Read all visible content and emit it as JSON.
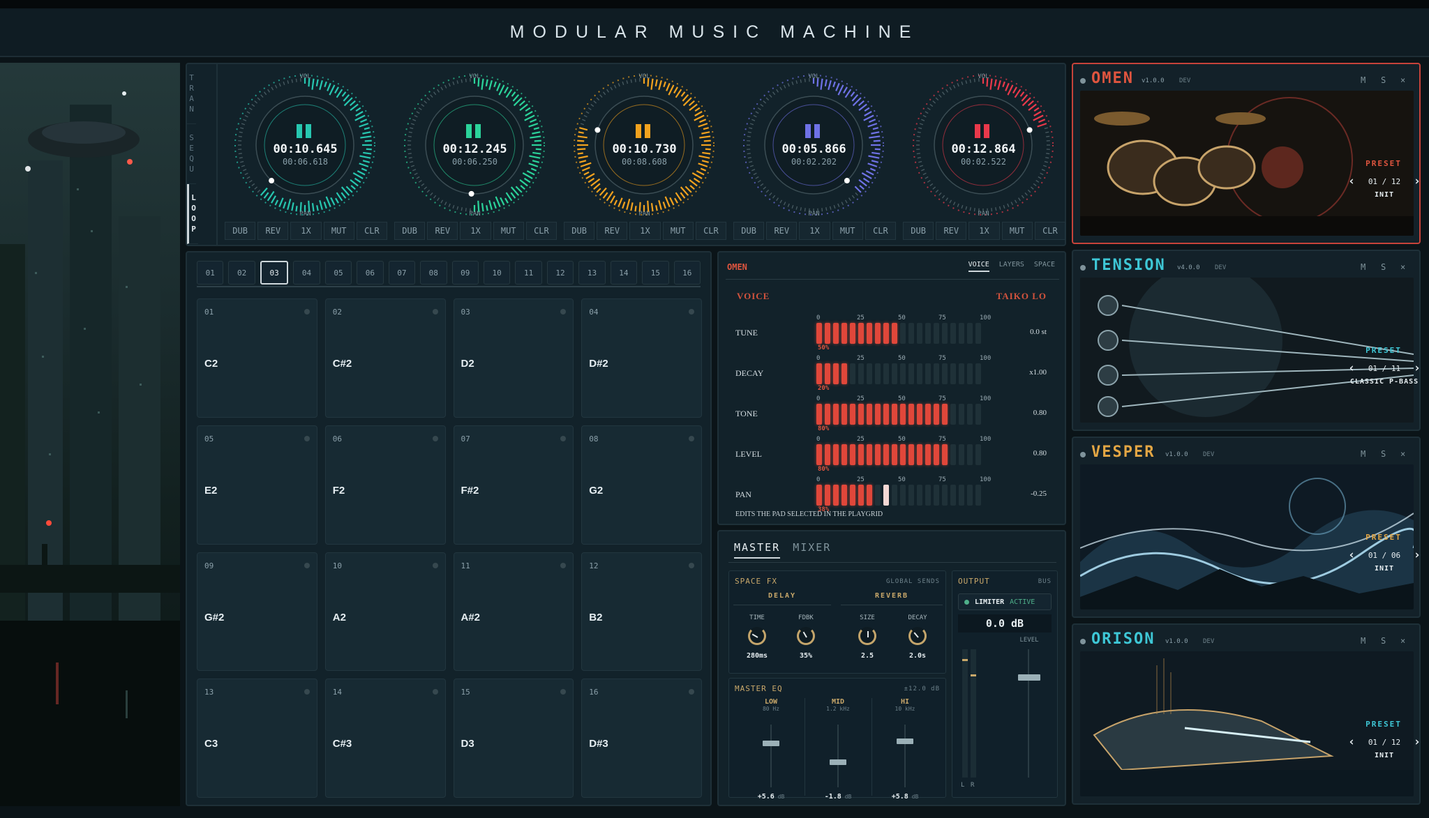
{
  "app": {
    "title": "MODULAR MUSIC MACHINE"
  },
  "transport": {
    "modes": [
      "TRAN",
      "SEQU",
      "LOOP"
    ],
    "active_mode": "LOOP",
    "decks": [
      {
        "color": "#27c7b0",
        "time": "00:10.645",
        "sub": "00:06.618",
        "vol_label": "VOL",
        "pan_label": "PAN",
        "buttons": [
          "DUB",
          "REV",
          "1X",
          "MUT",
          "CLR"
        ],
        "progress": 0.62
      },
      {
        "color": "#2bd39a",
        "time": "00:12.245",
        "sub": "00:06.250",
        "vol_label": "VOL",
        "pan_label": "PAN",
        "buttons": [
          "DUB",
          "REV",
          "1X",
          "MUT",
          "CLR"
        ],
        "progress": 0.51
      },
      {
        "color": "#f2a21e",
        "time": "00:10.730",
        "sub": "00:08.608",
        "vol_label": "VOL",
        "pan_label": "PAN",
        "buttons": [
          "DUB",
          "REV",
          "1X",
          "MUT",
          "CLR"
        ],
        "progress": 0.8
      },
      {
        "color": "#6f72e6",
        "time": "00:05.866",
        "sub": "00:02.202",
        "vol_label": "VOL",
        "pan_label": "PAN",
        "buttons": [
          "DUB",
          "REV",
          "1X",
          "MUT",
          "CLR"
        ],
        "progress": 0.38
      },
      {
        "color": "#e9394b",
        "time": "00:12.864",
        "sub": "00:02.522",
        "vol_label": "VOL",
        "pan_label": "PAN",
        "buttons": [
          "DUB",
          "REV",
          "1X",
          "MUT",
          "CLR"
        ],
        "progress": 0.2
      }
    ]
  },
  "pads": {
    "tabs": [
      "01",
      "02",
      "03",
      "04",
      "05",
      "06",
      "07",
      "08",
      "09",
      "10",
      "11",
      "12",
      "13",
      "14",
      "15",
      "16"
    ],
    "active_tab": "03",
    "items": [
      {
        "num": "01",
        "note": "C2"
      },
      {
        "num": "02",
        "note": "C#2"
      },
      {
        "num": "03",
        "note": "D2"
      },
      {
        "num": "04",
        "note": "D#2"
      },
      {
        "num": "05",
        "note": "E2"
      },
      {
        "num": "06",
        "note": "F2"
      },
      {
        "num": "07",
        "note": "F#2"
      },
      {
        "num": "08",
        "note": "G2"
      },
      {
        "num": "09",
        "note": "G#2"
      },
      {
        "num": "10",
        "note": "A2"
      },
      {
        "num": "11",
        "note": "A#2"
      },
      {
        "num": "12",
        "note": "B2"
      },
      {
        "num": "13",
        "note": "C3"
      },
      {
        "num": "14",
        "note": "C#3"
      },
      {
        "num": "15",
        "note": "D3"
      },
      {
        "num": "16",
        "note": "D#3"
      }
    ]
  },
  "voice": {
    "instrument": "OMEN",
    "tabs": [
      "VOICE",
      "LAYERS",
      "SPACE"
    ],
    "active_tab": "VOICE",
    "label": "VOICE",
    "preset": "TAIKO LO",
    "ticks": [
      "0",
      "25",
      "50",
      "75",
      "100"
    ],
    "params": [
      {
        "name": "TUNE",
        "percent": "50%",
        "value": "0.0 st",
        "level": 0.5
      },
      {
        "name": "DECAY",
        "percent": "20%",
        "value": "x1.00",
        "level": 0.2
      },
      {
        "name": "TONE",
        "percent": "80%",
        "value": "0.80",
        "level": 0.8
      },
      {
        "name": "LEVEL",
        "percent": "80%",
        "value": "0.80",
        "level": 0.8
      },
      {
        "name": "PAN",
        "percent": "38%",
        "value": "-0.25",
        "level": 0.38
      }
    ],
    "note": "EDITS THE PAD SELECTED IN THE PLAYGRID"
  },
  "master": {
    "tabs": [
      "MASTER",
      "MIXER"
    ],
    "active_tab": "MASTER",
    "space_fx": {
      "title": "SPACE FX",
      "sub": "GLOBAL SENDS",
      "delay": "DELAY",
      "reverb": "REVERB",
      "knobs": [
        {
          "label": "TIME",
          "value": "280ms"
        },
        {
          "label": "FDBK",
          "value": "35%"
        },
        {
          "label": "SIZE",
          "value": "2.5"
        },
        {
          "label": "DECAY",
          "value": "2.0s"
        }
      ]
    },
    "eq": {
      "title": "MASTER EQ",
      "range": "±12.0 dB",
      "bands": [
        {
          "name": "LOW",
          "freq": "80 Hz",
          "value": "+5.6",
          "unit": "dB",
          "pos": 0.25
        },
        {
          "name": "MID",
          "freq": "1.2 kHz",
          "value": "-1.8",
          "unit": "dB",
          "pos": 0.55
        },
        {
          "name": "HI",
          "freq": "10 kHz",
          "value": "+5.8",
          "unit": "dB",
          "pos": 0.22
        }
      ]
    },
    "output": {
      "title": "OUTPUT",
      "sub": "BUS",
      "limiter": "LIMITER",
      "limiter_state": "ACTIVE",
      "db": "0.0 dB",
      "level_label": "LEVEL",
      "l": "L",
      "r": "R"
    }
  },
  "instruments": [
    {
      "name": "OMEN",
      "version": "v1.0.0",
      "dev": "DEV",
      "color": "#e0553f",
      "preset_label": "PRESET",
      "counter": "01 / 12",
      "preset": "INIT",
      "m": "M",
      "s": "S",
      "x": "×",
      "art": "drums"
    },
    {
      "name": "TENSION",
      "version": "v4.0.0",
      "dev": "DEV",
      "color": "#3ec7d6",
      "preset_label": "PRESET",
      "counter": "01 / 11",
      "preset": "CLASSIC P-BASS",
      "m": "M",
      "s": "S",
      "x": "×",
      "art": "bass"
    },
    {
      "name": "VESPER",
      "version": "v1.0.0",
      "dev": "DEV",
      "color": "#e3a644",
      "preset_label": "PRESET",
      "counter": "01 / 06",
      "preset": "INIT",
      "m": "M",
      "s": "S",
      "x": "×",
      "art": "waves"
    },
    {
      "name": "ORISON",
      "version": "v1.0.0",
      "dev": "DEV",
      "color": "#3ec7d6",
      "preset_label": "PRESET",
      "counter": "01 / 12",
      "preset": "INIT",
      "m": "M",
      "s": "S",
      "x": "×",
      "art": "keys"
    }
  ]
}
